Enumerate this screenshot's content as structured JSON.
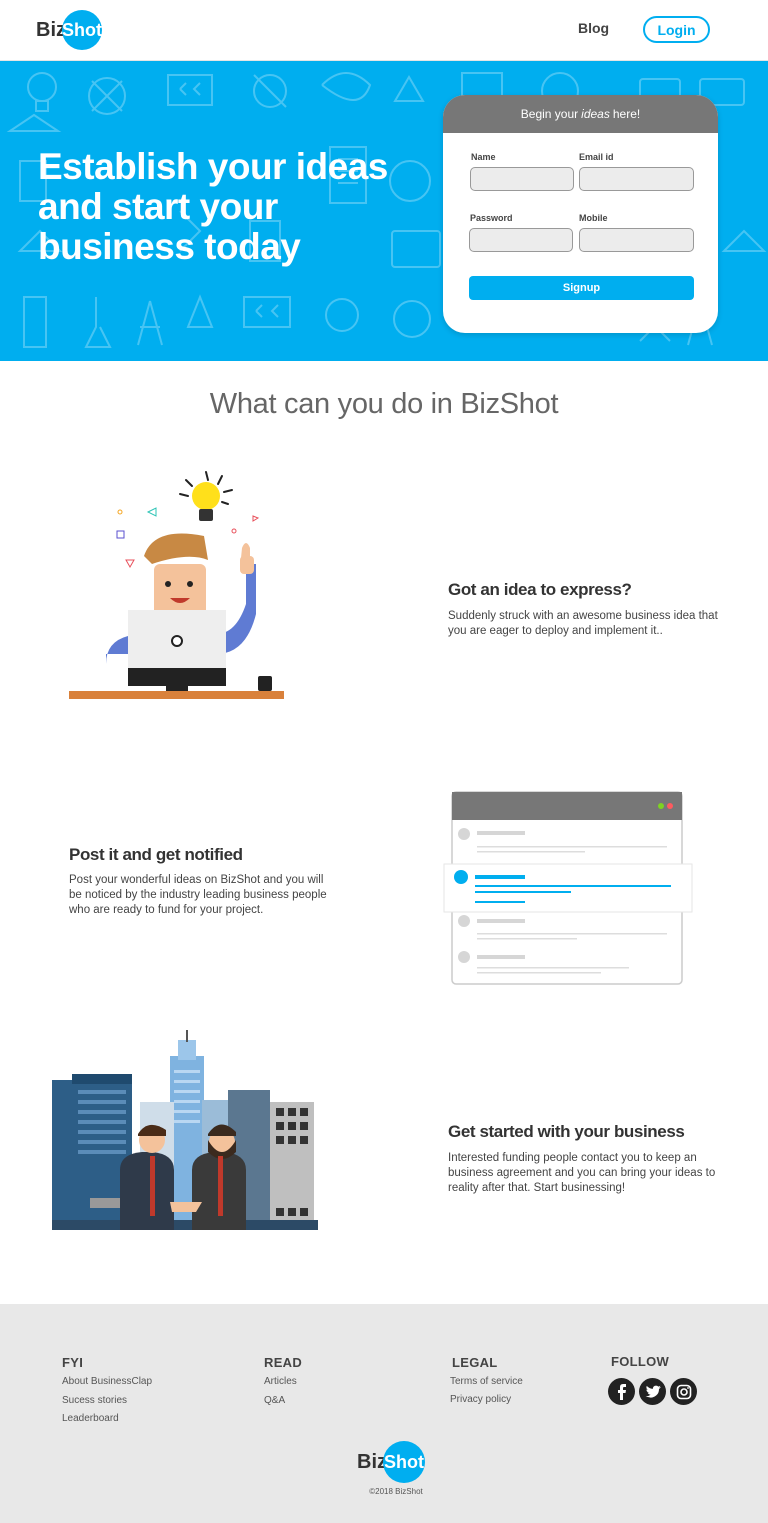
{
  "header": {
    "logo_biz": "Biz",
    "logo_shot": "Shot",
    "blog_label": "Blog",
    "login_label": "Login"
  },
  "hero": {
    "title_line1": "Establish your ideas",
    "title_line2": "and start your",
    "title_line3": "business today",
    "form": {
      "heading_before": "Begin your",
      "heading_emphasis": "ideas",
      "heading_after": "here!",
      "name_label": "Name",
      "email_label": "Email id",
      "password_label": "Password",
      "mobile_label": "Mobile",
      "signup_label": "Signup"
    }
  },
  "section": {
    "title": "What can you do in BizShot"
  },
  "features": [
    {
      "title": "Got an idea to express?",
      "text": "Suddenly struck with an awesome business idea that you are eager to deploy and implement it.."
    },
    {
      "title": "Post it and get notified",
      "text": "Post your wonderful ideas on BizShot and you will be noticed by the industry leading business people who are ready to fund for your project."
    },
    {
      "title": "Get started with your business",
      "text": "Interested funding people contact you to keep an business agreement and you can bring your ideas to reality after that. Start businessing!"
    }
  ],
  "footer": {
    "fyi": {
      "title": "FYI",
      "links": [
        "About BusinessClap",
        "Sucess stories",
        "Leaderboard"
      ]
    },
    "read": {
      "title": "READ",
      "links": [
        "Articles",
        "Q&A"
      ]
    },
    "legal": {
      "title": "LEGAL",
      "links": [
        "Terms of service",
        "Privacy policy"
      ]
    },
    "follow": {
      "title": "FOLLOW",
      "icons": [
        "facebook-icon",
        "twitter-icon",
        "instagram-icon"
      ]
    },
    "logo_biz": "Biz",
    "logo_shot": "Shot",
    "copyright": "©2018 BizShot"
  },
  "colors": {
    "brand_blue": "#00aeef",
    "form_header": "#777777",
    "footer_bg": "#e8e8e8"
  }
}
